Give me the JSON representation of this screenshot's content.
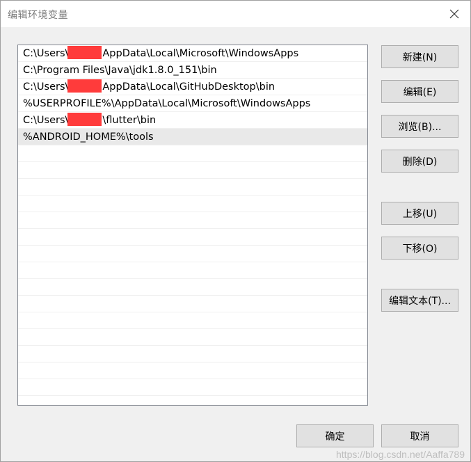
{
  "window": {
    "title": "编辑环境变量",
    "close_icon": "close-icon"
  },
  "paths": [
    {
      "prefix": "C:\\Users\\",
      "redacted": true,
      "suffix": "AppData\\Local\\Microsoft\\WindowsApps"
    },
    {
      "prefix": "C:\\Program Files\\Java\\jdk1.8.0_151\\bin",
      "redacted": false,
      "suffix": ""
    },
    {
      "prefix": "C:\\Users\\",
      "redacted": true,
      "suffix": "AppData\\Local\\GitHubDesktop\\bin"
    },
    {
      "prefix": "%USERPROFILE%\\AppData\\Local\\Microsoft\\WindowsApps",
      "redacted": false,
      "suffix": ""
    },
    {
      "prefix": "C:\\Users\\",
      "redacted": true,
      "suffix": "\\flutter\\bin"
    },
    {
      "prefix": "%ANDROID_HOME%\\tools",
      "redacted": false,
      "suffix": "",
      "selected": true
    }
  ],
  "buttons": {
    "new": "新建(N)",
    "edit": "编辑(E)",
    "browse": "浏览(B)...",
    "delete": "删除(D)",
    "move_up": "上移(U)",
    "move_down": "下移(O)",
    "edit_text": "编辑文本(T)...",
    "ok": "确定",
    "cancel": "取消"
  },
  "watermark": "https://blog.csdn.net/Aaffa789",
  "colors": {
    "redaction": "#ff3b3b",
    "selected_row": "#e9e9e9",
    "button_face": "#e1e1e1"
  }
}
